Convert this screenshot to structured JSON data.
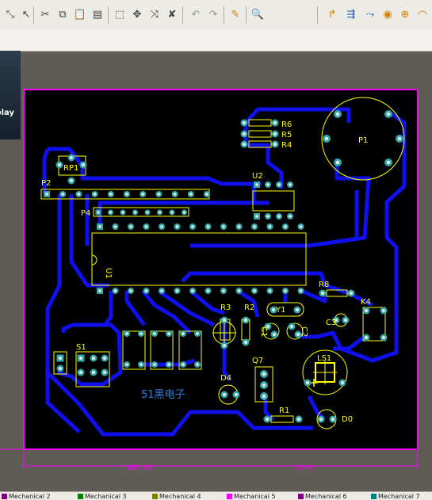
{
  "toolbar": {
    "icons": [
      "cut-icon",
      "copy-icon",
      "paste-icon",
      "paste-special-icon",
      "select-rect-icon",
      "move-icon",
      "cross-select-icon",
      "deselect-icon",
      "undo-icon",
      "redo-icon",
      "highlight-icon",
      "zoom-icon",
      "route-icon",
      "route-diff-icon",
      "fanout-icon",
      "via-icon",
      "pad-icon",
      "arc-icon"
    ]
  },
  "left_panel": {
    "label": "play"
  },
  "board": {
    "components": {
      "rp1": "RP1",
      "p2": "P2",
      "p4": "P4",
      "u1": "U1",
      "u2": "U2",
      "r6": "R6",
      "r5": "R5",
      "r4": "R4",
      "p1": "P1",
      "r8": "R8",
      "k4": "K4",
      "c3": "C3",
      "r3": "R3",
      "r2": "R2",
      "y1": "Y1",
      "c1": "C1",
      "c2": "C2",
      "d4": "D4",
      "q7": "Q7",
      "ls1": "LS1",
      "r1": "R1",
      "d0": "D0",
      "s1": "S1"
    },
    "brand_text": "51黑电子",
    "dim_width_label": "580 mil",
    "dim_height_label": "1mm"
  },
  "tabs": [
    {
      "label": "Mechanical 2",
      "color": "#7a007a"
    },
    {
      "label": "Mechanical 3",
      "color": "#008000"
    },
    {
      "label": "Mechanical 4",
      "color": "#808000"
    },
    {
      "label": "Mechanical 5",
      "color": "#ff00ff"
    },
    {
      "label": "Mechanical 6",
      "color": "#800080"
    },
    {
      "label": "Mechanical 7",
      "color": "#008080"
    }
  ],
  "colors": {
    "board_bg": "#000000",
    "trace": "#1010ee",
    "silk": "#ffff00",
    "outline": "#ff00ff",
    "pad": "#30a8a8",
    "workspace": "#5f5b56"
  }
}
